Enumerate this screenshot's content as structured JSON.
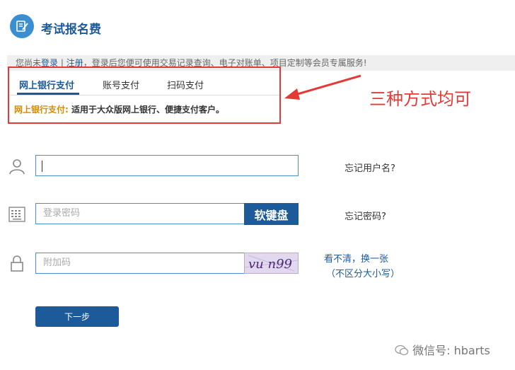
{
  "header": {
    "title": "考试报名费"
  },
  "notice": {
    "prefix": "您尚未",
    "login": "登录",
    "sep": " | ",
    "register": "注册",
    "suffix": "，登录后您便可使用交易记录查询、电子对账单、项目定制等会员专属服务!"
  },
  "tabs": [
    "网上银行支付",
    "账号支付",
    "扫码支付"
  ],
  "active_tab": "网上银行支付",
  "description": {
    "label": "网上银行支付:",
    "text": "适用于大众版网上银行、便捷支付客户。"
  },
  "annotation": "三种方式均可",
  "form": {
    "username": {
      "value": "",
      "link": "忘记用户名?"
    },
    "password": {
      "placeholder": "登录密码",
      "keyboard_button": "软键盘",
      "link": "忘记密码?"
    },
    "captcha": {
      "placeholder": "附加码",
      "image_text": "vu n99",
      "refresh_link": "看不清，换一张",
      "hint": "（不区分大小写）"
    }
  },
  "next_button": "下一步",
  "watermark": "微信号: hbarts",
  "colors": {
    "brand": "#1c5a9a",
    "accent_red": "#e53935",
    "highlight_orange": "#d78a00"
  }
}
